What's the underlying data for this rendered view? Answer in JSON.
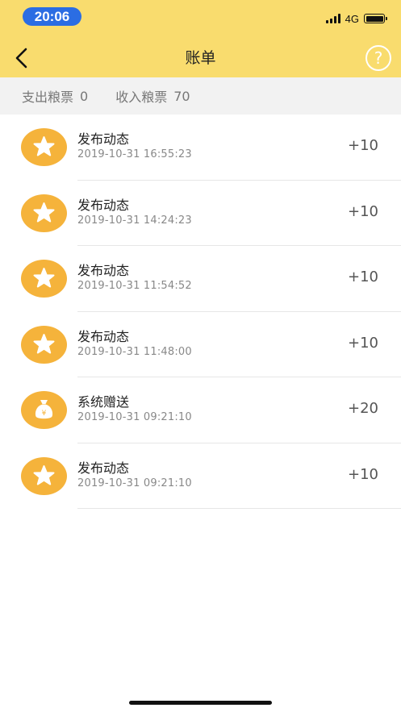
{
  "status_bar": {
    "time": "20:06",
    "network": "4G"
  },
  "header": {
    "title": "账单",
    "help_label": "?"
  },
  "summary": {
    "expense_label": "支出粮票",
    "expense_value": "0",
    "income_label": "收入粮票",
    "income_value": "70"
  },
  "colors": {
    "header_bg": "#F9DC6E",
    "icon_bg": "#F5B33B",
    "time_pill": "#2B6DE3"
  },
  "transactions": [
    {
      "icon": "star-icon",
      "title": "发布动态",
      "time": "2019-10-31 16:55:23",
      "amount": "+10"
    },
    {
      "icon": "star-icon",
      "title": "发布动态",
      "time": "2019-10-31 14:24:23",
      "amount": "+10"
    },
    {
      "icon": "star-icon",
      "title": "发布动态",
      "time": "2019-10-31 11:54:52",
      "amount": "+10"
    },
    {
      "icon": "star-icon",
      "title": "发布动态",
      "time": "2019-10-31 11:48:00",
      "amount": "+10"
    },
    {
      "icon": "money-bag-icon",
      "title": "系统赠送",
      "time": "2019-10-31 09:21:10",
      "amount": "+20"
    },
    {
      "icon": "star-icon",
      "title": "发布动态",
      "time": "2019-10-31 09:21:10",
      "amount": "+10"
    }
  ]
}
